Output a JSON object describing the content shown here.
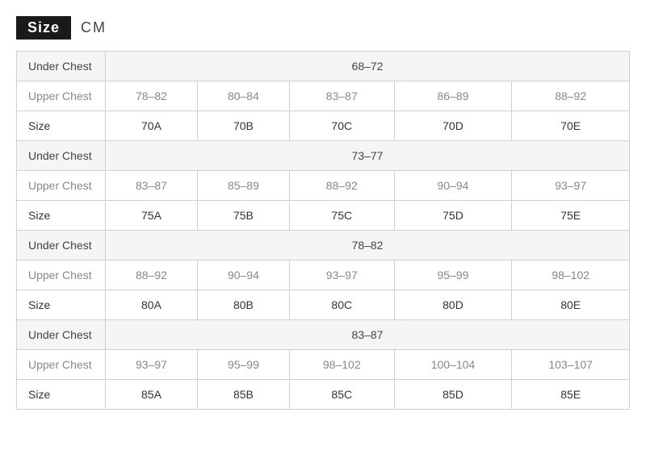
{
  "header": {
    "size_label": "Size",
    "unit_label": "CM"
  },
  "sections": [
    {
      "under_chest_label": "Under Chest",
      "under_chest_value": "68–72",
      "upper_chest_label": "Upper Chest",
      "upper_chest_values": [
        "78–82",
        "80–84",
        "83–87",
        "86–89",
        "88–92"
      ],
      "size_label": "Size",
      "size_values": [
        "70A",
        "70B",
        "70C",
        "70D",
        "70E"
      ]
    },
    {
      "under_chest_label": "Under Chest",
      "under_chest_value": "73–77",
      "upper_chest_label": "Upper Chest",
      "upper_chest_values": [
        "83–87",
        "85–89",
        "88–92",
        "90–94",
        "93–97"
      ],
      "size_label": "Size",
      "size_values": [
        "75A",
        "75B",
        "75C",
        "75D",
        "75E"
      ]
    },
    {
      "under_chest_label": "Under Chest",
      "under_chest_value": "78–82",
      "upper_chest_label": "Upper Chest",
      "upper_chest_values": [
        "88–92",
        "90–94",
        "93–97",
        "95–99",
        "98–102"
      ],
      "size_label": "Size",
      "size_values": [
        "80A",
        "80B",
        "80C",
        "80D",
        "80E"
      ]
    },
    {
      "under_chest_label": "Under Chest",
      "under_chest_value": "83–87",
      "upper_chest_label": "Upper Chest",
      "upper_chest_values": [
        "93–97",
        "95–99",
        "98–102",
        "100–104",
        "103–107"
      ],
      "size_label": "Size",
      "size_values": [
        "85A",
        "85B",
        "85C",
        "85D",
        "85E"
      ]
    }
  ]
}
